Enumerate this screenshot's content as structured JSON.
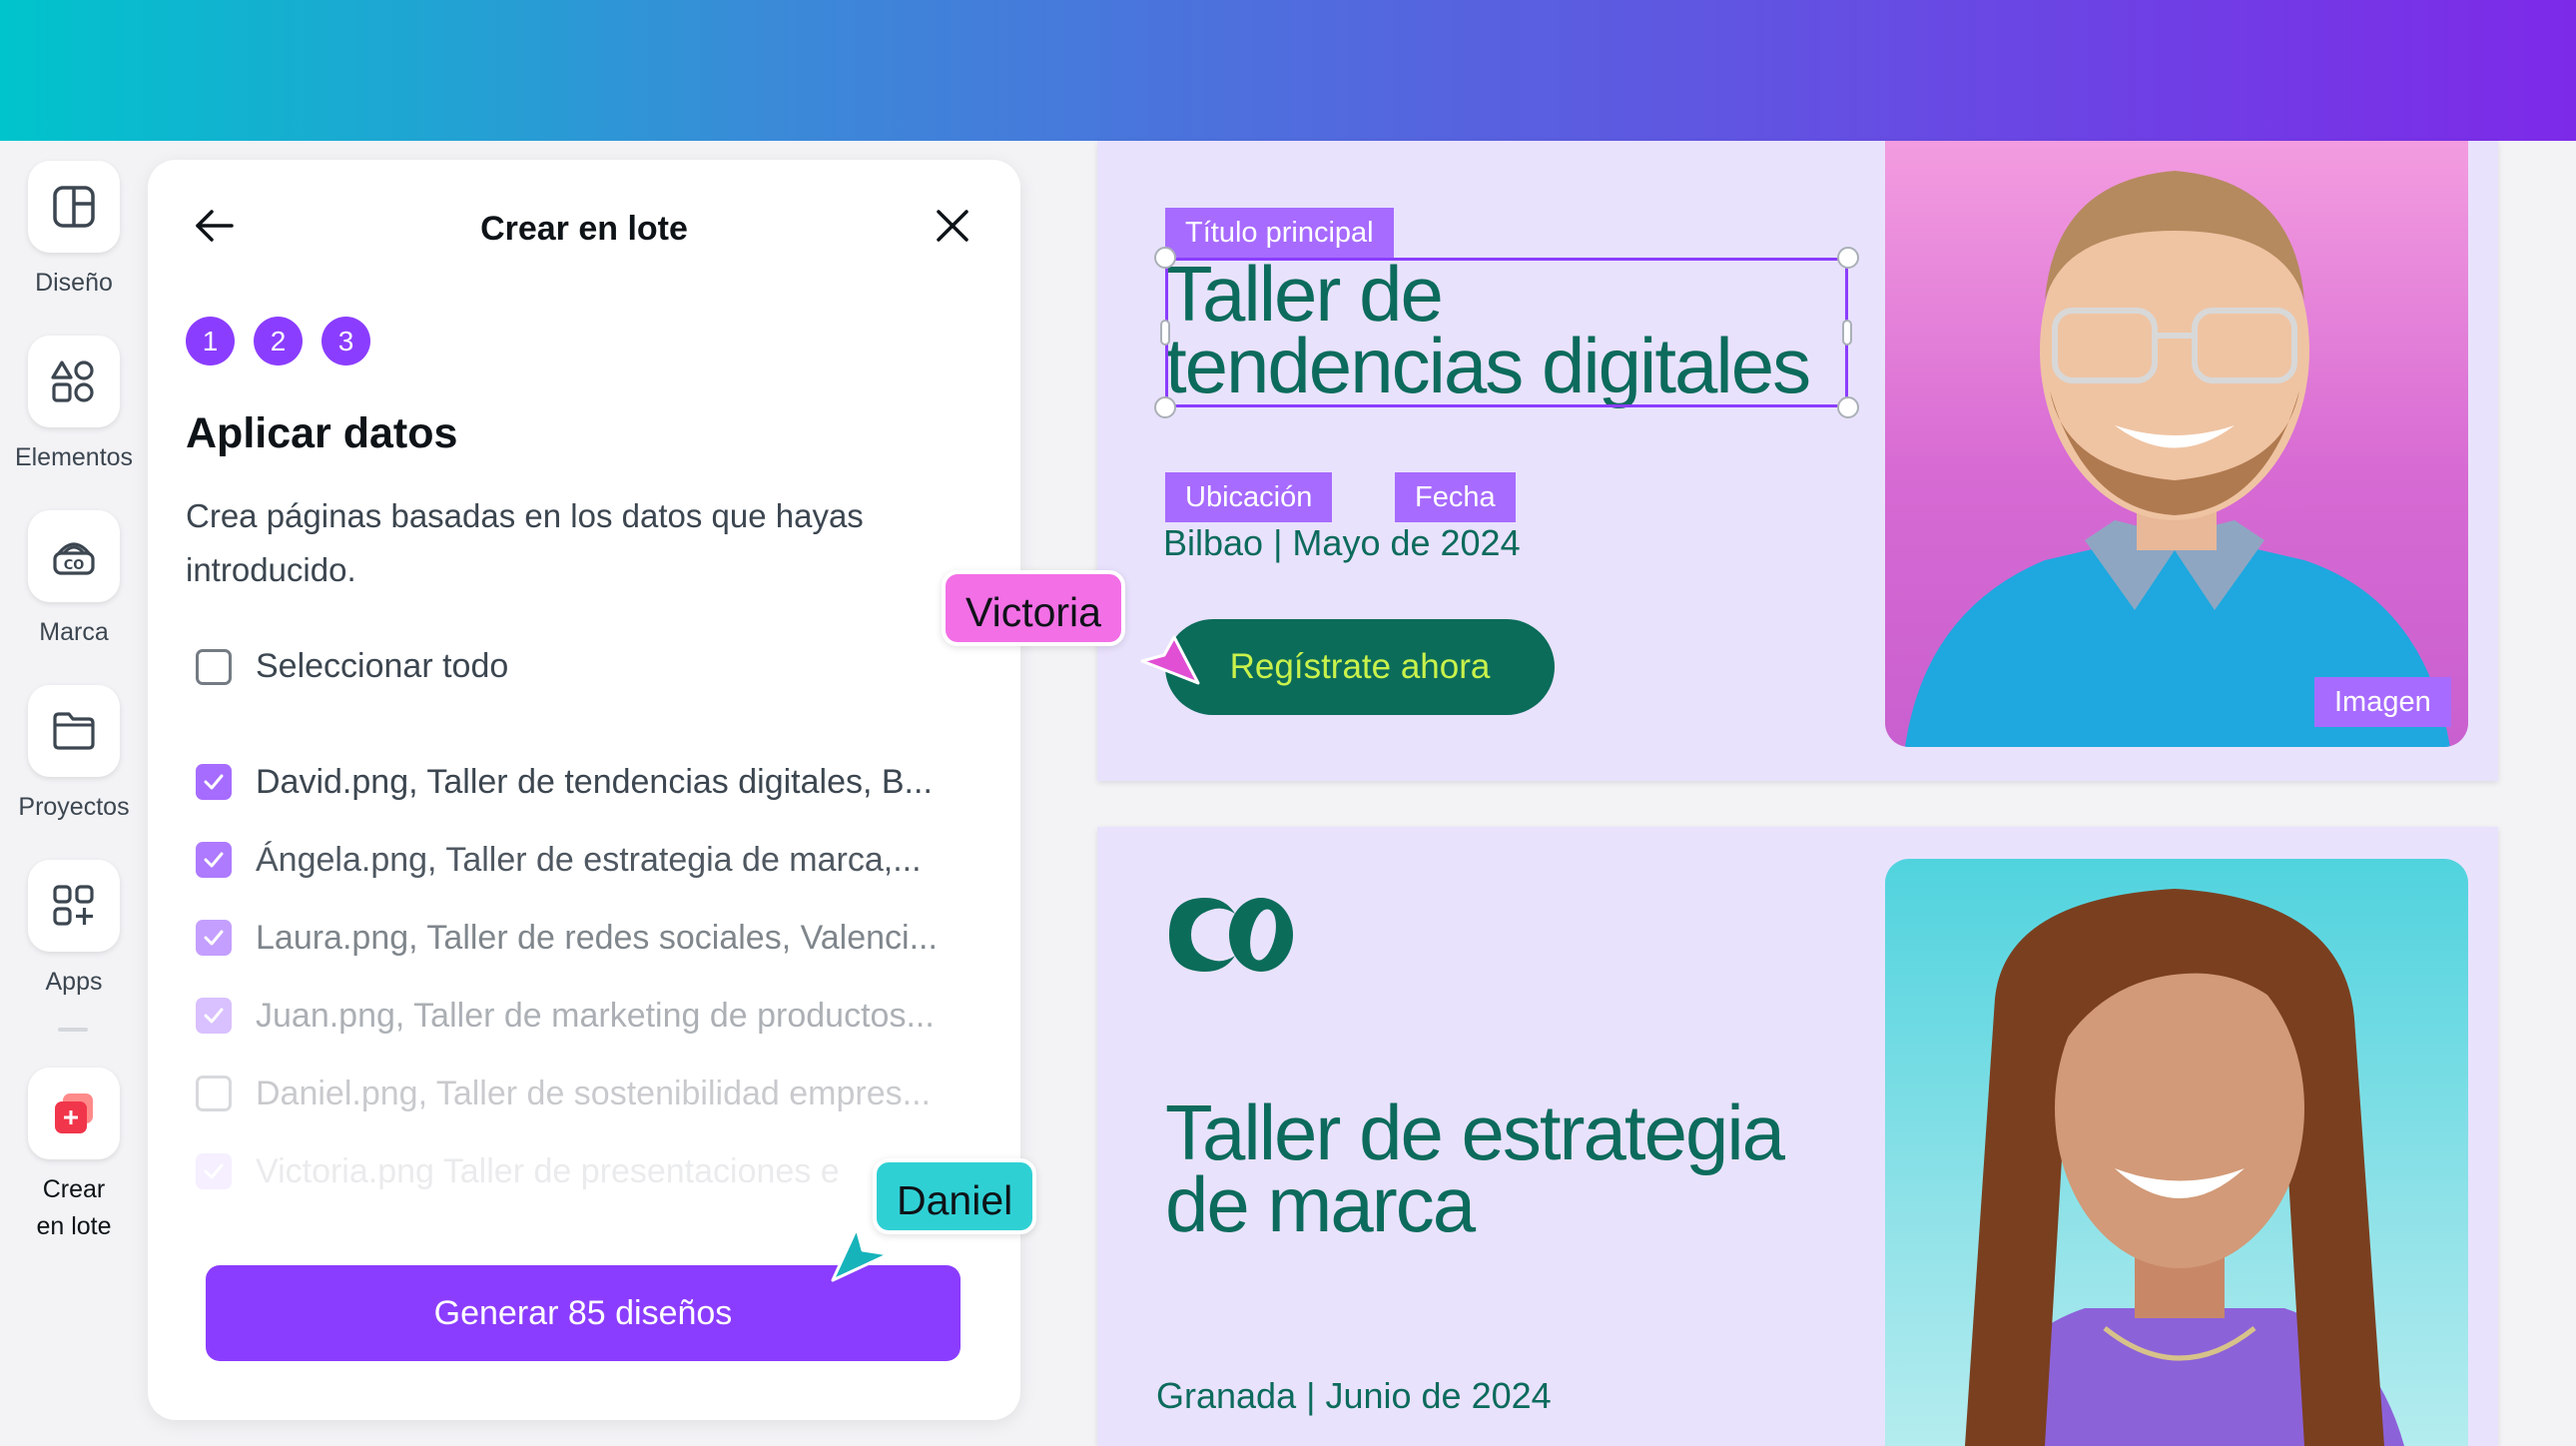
{
  "rail": {
    "items": [
      {
        "label": "Diseño",
        "icon": "layout-icon"
      },
      {
        "label": "Elementos",
        "icon": "shapes-icon"
      },
      {
        "label": "Marca",
        "icon": "brand-icon"
      },
      {
        "label": "Proyectos",
        "icon": "folder-icon"
      },
      {
        "label": "Apps",
        "icon": "apps-icon"
      },
      {
        "label_line1": "Crear",
        "label_line2": "en lote",
        "icon": "bulk-create-icon"
      }
    ]
  },
  "panel": {
    "title": "Crear en lote",
    "steps": [
      "1",
      "2",
      "3"
    ],
    "step_title": "Aplicar datos",
    "description": "Crea páginas basadas en los datos que hayas introducido.",
    "select_all": "Seleccionar todo",
    "rows": [
      {
        "text": "David.png, Taller de tendencias digitales, B...",
        "checked": true
      },
      {
        "text": "Ángela.png, Taller de estrategia de marca,...",
        "checked": true
      },
      {
        "text": "Laura.png, Taller de redes sociales, Valenci...",
        "checked": true
      },
      {
        "text": "Juan.png, Taller de marketing de productos...",
        "checked": true
      },
      {
        "text": "Daniel.png, Taller de sostenibilidad empres...",
        "checked": false
      },
      {
        "text": "Victoria.png Taller de presentaciones e",
        "checked": true
      }
    ],
    "generate_button": "Generar 85 diseños"
  },
  "canvas": {
    "page1": {
      "title_tag": "Título principal",
      "title": "Taller de tendencias digitales",
      "title_line1": "Taller de",
      "title_line2": "tendencias digitales",
      "location_tag": "Ubicación",
      "date_tag": "Fecha",
      "location_date": "Bilbao | Mayo de 2024",
      "cta": "Regístrate ahora",
      "image_tag": "Imagen"
    },
    "page2": {
      "title_line1": "Taller de estrategia",
      "title_line2": "de marca",
      "location_date": "Granada | Junio de 2024"
    }
  },
  "collaborators": [
    {
      "name": "Victoria",
      "color": "#f36fe6"
    },
    {
      "name": "Daniel",
      "color": "#2fd0d4"
    }
  ],
  "colors": {
    "accent": "#8b3dff",
    "brand_green": "#0b6c5a",
    "tag_purple": "#a76bff",
    "canvas_bg": "#e9e2fd"
  }
}
